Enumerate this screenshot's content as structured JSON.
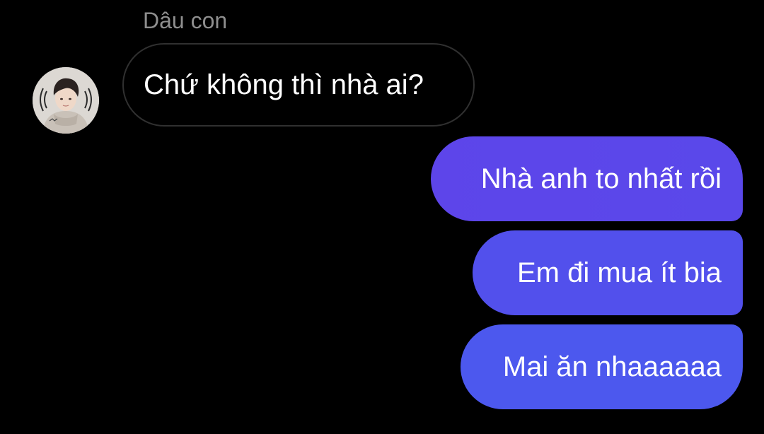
{
  "conversation": {
    "sender_name": "Dâu con",
    "avatar": {
      "icon": "contact-avatar-photo"
    },
    "incoming": [
      {
        "text": "Chứ không thì nhà ai?"
      }
    ],
    "outgoing": [
      {
        "text": "Nhà anh to nhất rồi"
      },
      {
        "text": "Em đi mua ít bia"
      },
      {
        "text": "Mai ăn nhaaaaaa"
      }
    ]
  },
  "colors": {
    "background": "#000000",
    "incoming_border": "#303030",
    "outgoing_top": "#5d45ea",
    "outgoing_middle": "#5250ec",
    "outgoing_bottom": "#4c58ee",
    "sender_name": "#8e8e8e"
  }
}
